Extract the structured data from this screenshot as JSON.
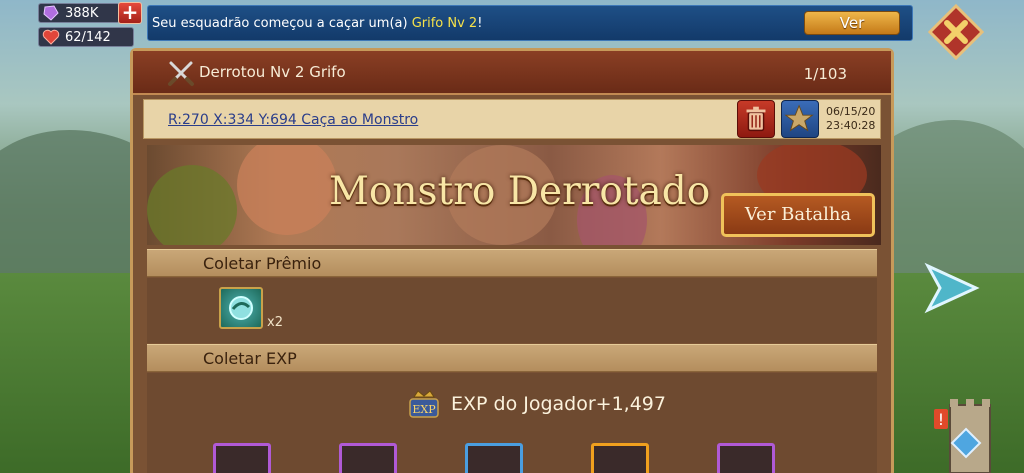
{
  "resources": {
    "gems": "388K",
    "stamina": "62/142",
    "plus_label": "+"
  },
  "notification": {
    "text_before": "Seu esquadrão começou a caçar um(a) ",
    "highlight": "Grifo Nv 2",
    "text_after": "!",
    "button_label": "Ver"
  },
  "report": {
    "title": "Derrotou Nv 2 Grifo",
    "counter": "1/103",
    "location": "R:270 X:334 Y:694 Caça ao Monstro",
    "date": "06/15/20",
    "time": "23:40:28",
    "banner_title": "Monstro Derrotado",
    "battle_button": "Ver Batalha"
  },
  "rewards": {
    "header": "Coletar Prêmio",
    "items": [
      {
        "icon": "teal-orb-item-icon",
        "qty": "x2"
      }
    ]
  },
  "exp": {
    "header": "Coletar EXP",
    "player_exp": "EXP do Jogador+1,497",
    "icon_label": "EXP"
  },
  "colors": {
    "accent_gold": "#f0c25a",
    "notif_blue": "#1e4f86",
    "highlight_yellow": "#f6e24a"
  }
}
